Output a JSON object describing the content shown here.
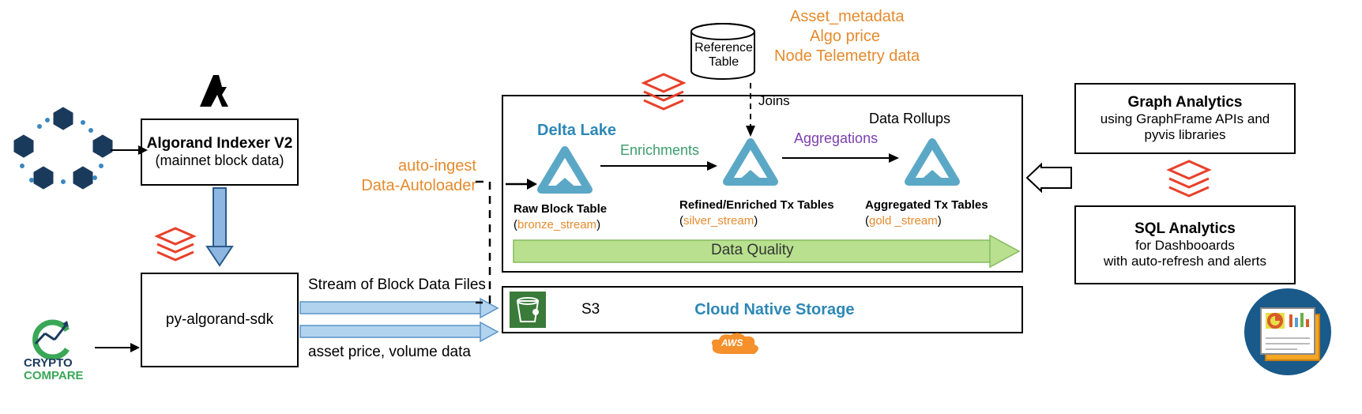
{
  "indexer": {
    "title": "Algorand Indexer V2",
    "subtitle": "(mainnet block data)"
  },
  "sdk": {
    "title": "py-algorand-sdk"
  },
  "stream_labels": {
    "top": "Stream of Block Data Files",
    "bottom": "asset price, volume data"
  },
  "autoloader": {
    "l1": "auto-ingest",
    "l2": "Data-Autoloader"
  },
  "deltalake": {
    "title": "Delta Lake"
  },
  "tables": {
    "raw": {
      "t1": "Raw  Block  Table",
      "t2": "(",
      "t3": "bronze_stream",
      "t4": ")"
    },
    "refined": {
      "t1": "Refined/Enriched Tx Tables",
      "t2": "(",
      "t3": "silver_stream",
      "t4": ")"
    },
    "agg": {
      "t1": "Aggregated  Tx Tables",
      "t2": "(",
      "t3": "gold _stream",
      "t4": ")"
    }
  },
  "arrows": {
    "enrich": "Enrichments",
    "aggs": "Aggregations",
    "rollups": "Data Rollups",
    "quality": "Data Quality"
  },
  "reference": {
    "title": "Reference Table",
    "joins": "Joins",
    "meta1": "Asset_metadata",
    "meta2": "Algo price",
    "meta3": "Node Telemetry data"
  },
  "storage": {
    "s3": "S3",
    "cloud": "Cloud Native Storage",
    "aws": "AWS"
  },
  "graph": {
    "t": "Graph Analytics",
    "d": "using GraphFrame APIs and pyvis libraries"
  },
  "sql": {
    "t": "SQL Analytics",
    "d1": "for Dashbooards",
    "d2": "with auto-refresh and alerts"
  },
  "crypto": {
    "l1": "CRYPTO",
    "l2": "COMPARE"
  }
}
